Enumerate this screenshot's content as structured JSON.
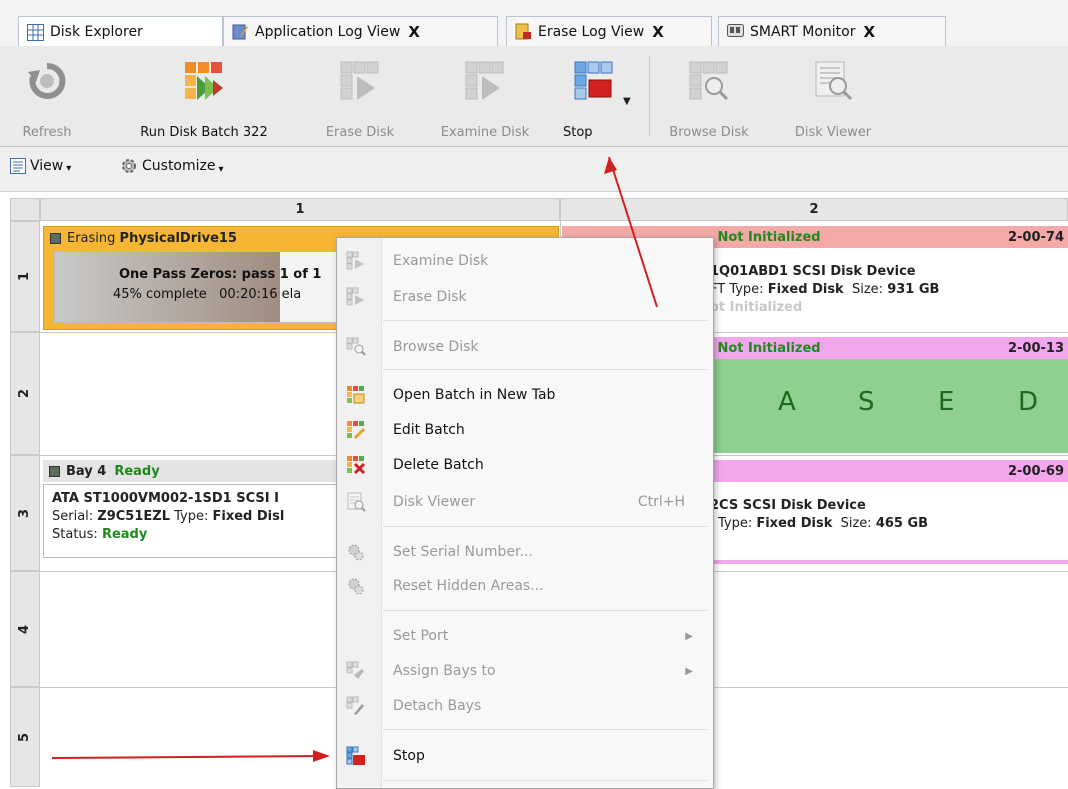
{
  "tabs": [
    {
      "label": "Disk Explorer",
      "closable": false,
      "icon": "grid-icon"
    },
    {
      "label": "Application Log View",
      "closable": true,
      "icon": "log-icon"
    },
    {
      "label": "Erase Log View",
      "closable": true,
      "icon": "erase-log-icon"
    },
    {
      "label": "SMART Monitor",
      "closable": true,
      "icon": "smart-monitor-icon"
    }
  ],
  "close_glyph": "X",
  "ribbon": {
    "refresh": "Refresh",
    "run_batch": "Run Disk Batch 322",
    "erase_disk": "Erase Disk",
    "examine_disk": "Examine Disk",
    "stop": "Stop",
    "browse_disk": "Browse Disk",
    "disk_viewer": "Disk Viewer"
  },
  "toolbar2": {
    "view": "View",
    "customize": "Customize"
  },
  "grid": {
    "columns": [
      "1",
      "2"
    ],
    "rows": [
      "1",
      "2",
      "3",
      "4",
      "5"
    ],
    "cells": {
      "r1c1": {
        "prefix": "Erasing ",
        "name": "PhysicalDrive15",
        "line1": "One Pass Zeros: pass 1 of 1",
        "line2": "45% complete   00:20:16 ela",
        "progress_percent": 45
      },
      "r1c2": {
        "status_fragment": ", Not Initialized",
        "id": "2-00-74",
        "model": "1Q01ABD1 SCSI Disk Device",
        "type_prefix": "FT Type: ",
        "type": "Fixed Disk",
        "size_label": "  Size: ",
        "size": "931 GB",
        "status2": "ot Initialized"
      },
      "r2c2": {
        "status_fragment": ", Not Initialized",
        "id": "2-00-13",
        "erased_letters": [
          "A",
          "S",
          "E",
          "D"
        ]
      },
      "r3c1": {
        "bay": "Bay 4",
        "status": "Ready",
        "model": "ATA ST1000VM002-1SD1 SCSI I",
        "serial_label": "Serial: ",
        "serial": "Z9C51EZL",
        "type_label": " Type: ",
        "type": "Fixed Disl",
        "status_label": "Status: ",
        "status_value": "Ready"
      },
      "r3c2": {
        "id": "2-00-69",
        "model": "2CS SCSI Disk Device",
        "type_prefix": "J Type: ",
        "type": "Fixed Disk",
        "size_label": "  Size: ",
        "size": "465 GB"
      }
    }
  },
  "context_menu": {
    "items": [
      {
        "label": "Examine Disk",
        "enabled": false
      },
      {
        "label": "Erase Disk",
        "enabled": false
      },
      {
        "label": "Browse Disk",
        "enabled": false
      },
      {
        "label": "Open Batch in New Tab",
        "enabled": true
      },
      {
        "label": "Edit Batch",
        "enabled": true
      },
      {
        "label": "Delete Batch",
        "enabled": true
      },
      {
        "label": "Disk Viewer",
        "enabled": false,
        "shortcut": "Ctrl+H"
      },
      {
        "label": "Set Serial Number...",
        "enabled": false
      },
      {
        "label": "Reset Hidden Areas...",
        "enabled": false
      },
      {
        "label": "Set Port",
        "enabled": false,
        "submenu": true
      },
      {
        "label": "Assign Bays to",
        "enabled": false,
        "submenu": true
      },
      {
        "label": "Detach Bays",
        "enabled": false
      },
      {
        "label": "Stop",
        "enabled": true
      }
    ]
  },
  "colors": {
    "erasing_header": "#f5b731",
    "not_init_header": "#f4a9a9",
    "pink_header": "#f2a7ec",
    "erased_bg": "#8fcf8f",
    "ready_green": "#1c8a1c",
    "arrow_red": "#d11f1f"
  }
}
